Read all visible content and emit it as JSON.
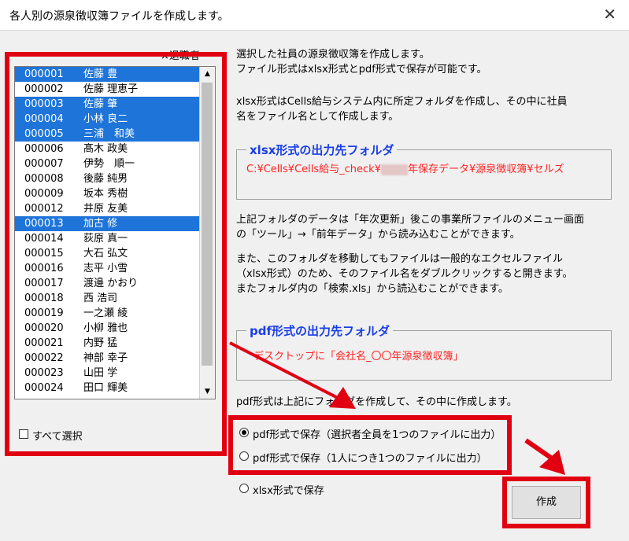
{
  "window": {
    "title": "各人別の源泉徴収簿ファイルを作成します。",
    "close": "✕"
  },
  "list": {
    "retired_label": "×退職者",
    "rows": [
      {
        "id": "000001",
        "name": "佐藤 豊",
        "selected": true
      },
      {
        "id": "000002",
        "name": "佐藤 理恵子",
        "selected": false
      },
      {
        "id": "000003",
        "name": "佐藤 肇",
        "selected": true
      },
      {
        "id": "000004",
        "name": "小林 良二",
        "selected": true
      },
      {
        "id": "000005",
        "name": "三浦　和美",
        "selected": true
      },
      {
        "id": "000006",
        "name": "髙木 政美",
        "selected": false
      },
      {
        "id": "000007",
        "name": "伊勢　順一",
        "selected": false
      },
      {
        "id": "000008",
        "name": "後藤 純男",
        "selected": false
      },
      {
        "id": "000009",
        "name": "坂本 秀樹",
        "selected": false
      },
      {
        "id": "000012",
        "name": "井原 友美",
        "selected": false
      },
      {
        "id": "000013",
        "name": "加古 修",
        "selected": true
      },
      {
        "id": "000014",
        "name": "荻原 真一",
        "selected": false
      },
      {
        "id": "000015",
        "name": "大石 弘文",
        "selected": false
      },
      {
        "id": "000016",
        "name": "志平 小雪",
        "selected": false
      },
      {
        "id": "000017",
        "name": "渡邊 かおり",
        "selected": false
      },
      {
        "id": "000018",
        "name": "西 浩司",
        "selected": false
      },
      {
        "id": "000019",
        "name": "一之瀬 綾",
        "selected": false
      },
      {
        "id": "000020",
        "name": "小柳 雅也",
        "selected": false
      },
      {
        "id": "000021",
        "name": "内野 猛",
        "selected": false
      },
      {
        "id": "000022",
        "name": "神部 幸子",
        "selected": false
      },
      {
        "id": "000023",
        "name": "山田 学",
        "selected": false
      },
      {
        "id": "000024",
        "name": "田口 輝美",
        "selected": false
      }
    ],
    "scroll_up": "▲",
    "scroll_down": "▼"
  },
  "select_all": "すべて選択",
  "description": {
    "line1": "選択した社員の源泉徴収簿を作成します。",
    "line2": "ファイル形式はxlsx形式とpdf形式で保存が可能です。",
    "line3": "xlsx形式はCells給与システム内に所定フォルダを作成し、その中に社員",
    "line4": "名をファイル名として作成します。",
    "line5": "上記フォルダのデータは「年次更新」後この事業所ファイルのメニュー画面",
    "line6": "の「ツール」→「前年データ」から読み込むことができます。",
    "line7": "また、このフォルダを移動してもファイルは一般的なエクセルファイル",
    "line8": "（xlsx形式）のため、そのファイル名をダブルクリックすると開きます。",
    "line9": "またフォルダ内の「検索.xls」から読込むことができます。",
    "pdf_note": "pdf形式は上記にフォルダを作成して、その中に作成します。"
  },
  "xlsx_folder": {
    "title": "xlsx形式の出力先フォルダ",
    "path_before": "C:¥Cells¥Cells給与_check¥",
    "path_after": "年保存データ¥源泉徴収簿¥セルズ"
  },
  "pdf_folder": {
    "title": "pdf形式の出力先フォルダ",
    "path": "デスクトップに「会社名_〇〇年源泉徴収簿」"
  },
  "options": [
    {
      "label": "pdf形式で保存（選択者全員を1つのファイルに出力）",
      "checked": true
    },
    {
      "label": "pdf形式で保存（1人につき1つのファイルに出力）",
      "checked": false
    },
    {
      "label": "xlsx形式で保存",
      "checked": false
    }
  ],
  "create_button": "作成",
  "colors": {
    "highlight": "#e00012",
    "selection": "#1e74d9",
    "frame_title": "#1a3ee6",
    "path_text": "#ff2222"
  }
}
